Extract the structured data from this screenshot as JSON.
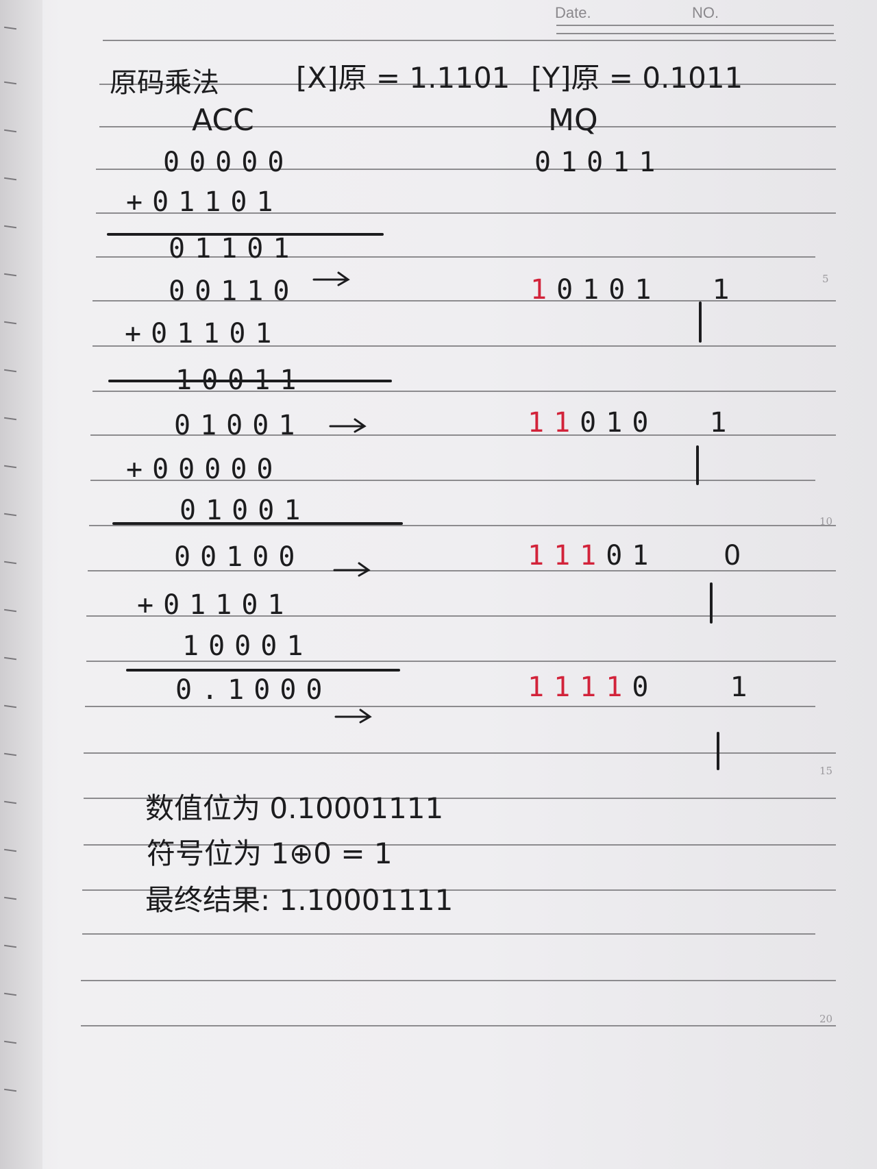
{
  "header": {
    "date_label": "Date.",
    "no_label": "NO."
  },
  "line_numbers": [
    "5",
    "10",
    "15",
    "20"
  ],
  "title": {
    "text": "原码乘法",
    "x_expr": "[X]原 = 1.1101",
    "y_expr": "[Y]原 = 0.1011"
  },
  "columns": {
    "acc": "ACC",
    "mq": "MQ"
  },
  "rows": [
    {
      "acc": "00000",
      "mq_red": "",
      "mq_black": "01011"
    },
    {
      "acc": "+01101"
    },
    {
      "acc": "01101"
    },
    {
      "acc": "00110",
      "mq_red": "1",
      "mq_black": "0101",
      "mq_tail": "1"
    },
    {
      "acc": "+01101"
    },
    {
      "acc": "10011"
    },
    {
      "acc": "01001",
      "mq_red": "11",
      "mq_black": "010",
      "mq_tail": "1"
    },
    {
      "acc": "+00000"
    },
    {
      "acc": "01001"
    },
    {
      "acc": "00100",
      "mq_red": "111",
      "mq_black": "01",
      "mq_tail": "0"
    },
    {
      "acc": "+01101"
    },
    {
      "acc": "10001"
    },
    {
      "acc": "0.1000",
      "mq_red": "1111",
      "mq_black": "0",
      "mq_tail": "1"
    }
  ],
  "results": {
    "value_bits": "数值位为 0.10001111",
    "sign_bit": "符号位为 1⊕0 = 1",
    "final": "最终结果: 1.10001111"
  },
  "colors": {
    "ink": "#1c1c1e",
    "red_ink": "#d2233a",
    "paper": "#efeef1",
    "rule": "#8c8b8e"
  }
}
